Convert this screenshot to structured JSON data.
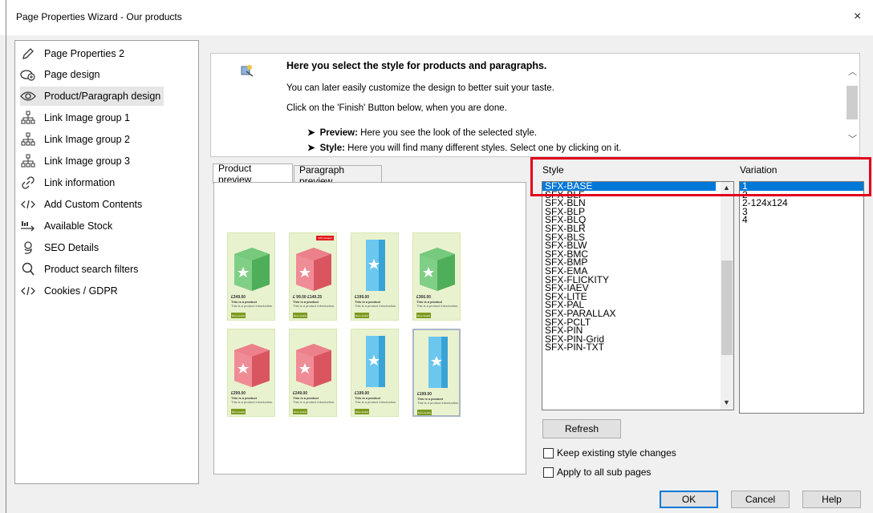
{
  "window": {
    "title": "Page Properties Wizard - Our products",
    "close_glyph": "×"
  },
  "sidebar": {
    "items": [
      {
        "label": "Page Properties 2",
        "icon": "pencil-icon"
      },
      {
        "label": "Page design",
        "icon": "page-design-icon"
      },
      {
        "label": "Product/Paragraph design",
        "icon": "eye-icon",
        "selected": true
      },
      {
        "label": "Link Image group 1",
        "icon": "sitemap-icon"
      },
      {
        "label": "Link Image group 2",
        "icon": "sitemap-icon"
      },
      {
        "label": "Link Image group 3",
        "icon": "sitemap-icon"
      },
      {
        "label": "Link information",
        "icon": "link-icon"
      },
      {
        "label": "Add Custom Contents",
        "icon": "code-icon"
      },
      {
        "label": "Available Stock",
        "icon": "stock-icon"
      },
      {
        "label": "SEO Details",
        "icon": "seo-icon"
      },
      {
        "label": "Product search filters",
        "icon": "search-icon"
      },
      {
        "label": "Cookies / GDPR",
        "icon": "code-icon"
      }
    ]
  },
  "info": {
    "heading": "Here you select the style for products and paragraphs.",
    "line1": "You can later easily customize the design to better suit your taste.",
    "line2": "Click on the 'Finish' Button below, when you are done.",
    "bullet1_bold": "Preview:",
    "bullet1_text": " Here you see the look of the selected style.",
    "bullet2_bold": "Style:",
    "bullet2_text": " Here you will find many different styles. Select one by clicking on it."
  },
  "tabs": {
    "product_preview": "Product preview",
    "paragraph_preview": "Paragraph preview"
  },
  "preview": {
    "cards": [
      {
        "color": "green",
        "price": "£349.00",
        "name": "This is a product",
        "desc": "This is a product introduction.",
        "button": "More details"
      },
      {
        "color": "red",
        "price": "£ 99.00 £149.25",
        "name": "This is a product",
        "desc": "This is a product introduction.",
        "button": "More details",
        "badge": "33% cheaper"
      },
      {
        "color": "blue",
        "price": "£199.00",
        "name": "This is a product",
        "desc": "This is a product introduction.",
        "button": "More details"
      },
      {
        "color": "green",
        "price": "£366.00",
        "name": "This is a product",
        "desc": "This is a product introduction.",
        "button": "More details"
      },
      {
        "color": "red",
        "price": "£299.00",
        "name": "This is a product",
        "desc": "This is a product introduction.",
        "button": "More details"
      },
      {
        "color": "red",
        "price": "£249.00",
        "name": "This is a product",
        "desc": "This is a product introduction.",
        "button": "More details"
      },
      {
        "color": "blue",
        "price": "£199.00",
        "name": "This is a product",
        "desc": "This is a product introduction.",
        "button": "More details"
      },
      {
        "color": "blue",
        "price": "£199.00",
        "name": "This is a product",
        "desc": "This is a product introduction.",
        "button": "More details",
        "highlight": true
      }
    ]
  },
  "style": {
    "label": "Style",
    "items": [
      "SFX-BASE",
      "SFX-BLF",
      "SFX-BLN",
      "SFX-BLP",
      "SFX-BLQ",
      "SFX-BLR",
      "SFX-BLS",
      "SFX-BLW",
      "SFX-BMC",
      "SFX-BMP",
      "SFX-EMA",
      "SFX-FLICKITY",
      "SFX-IAEV",
      "SFX-LITE",
      "SFX-PAL",
      "SFX-PARALLAX",
      "SFX-PCLT",
      "SFX-PIN",
      "SFX-PIN-Grid",
      "SFX-PIN-TXT"
    ],
    "selected": "SFX-BASE"
  },
  "variation": {
    "label": "Variation",
    "items": [
      "1",
      "2",
      "2-124x124",
      "3",
      "4"
    ],
    "selected": "1"
  },
  "buttons": {
    "refresh": "Refresh",
    "ok": "OK",
    "cancel": "Cancel",
    "help": "Help"
  },
  "checkboxes": {
    "keep_changes": "Keep existing style changes",
    "apply_sub": "Apply to all sub pages"
  },
  "colors": {
    "selection": "#0078d7",
    "highlight_box": "#e3001b",
    "card_bg": "#e9f2cf"
  }
}
